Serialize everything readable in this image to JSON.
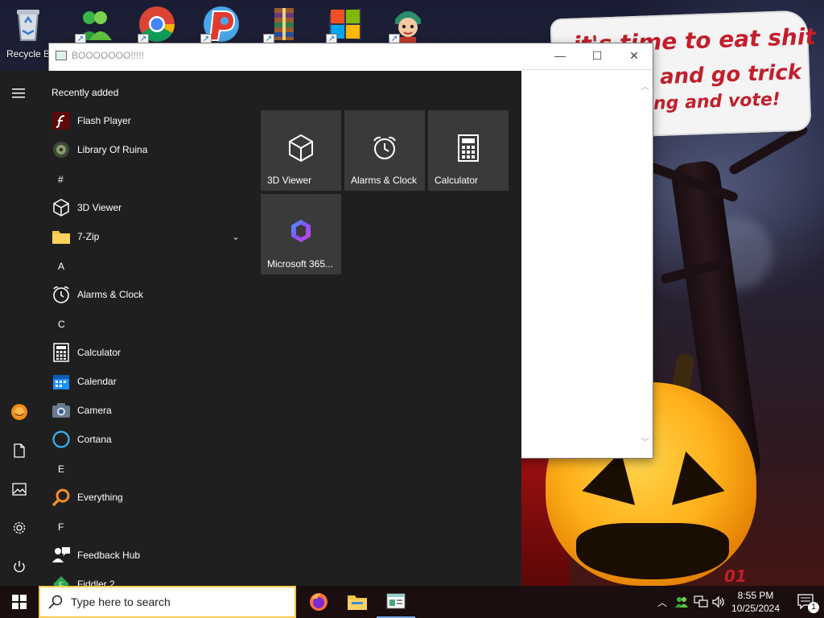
{
  "wallpaper": {
    "speech_lines": [
      "it's time to eat shit",
      "and go trick",
      "ng and vote!"
    ],
    "signature": "01"
  },
  "desktop": {
    "icons": [
      {
        "label": "Recycle B",
        "icon": "recycle-bin-icon"
      },
      {
        "label": "",
        "icon": "contacts-icon"
      },
      {
        "label": "",
        "icon": "chrome-icon"
      },
      {
        "label": "",
        "icon": "p-app-icon"
      },
      {
        "label": "",
        "icon": "winrar-icon"
      },
      {
        "label": "",
        "icon": "windows-logo-icon"
      },
      {
        "label": "",
        "icon": "character-icon"
      }
    ]
  },
  "window": {
    "title": "BOOOOOOO!!!!!",
    "minimize": "—",
    "maximize": "☐",
    "close": "✕"
  },
  "start_menu": {
    "recently_added_header": "Recently added",
    "apps": [
      {
        "name": "Flash Player",
        "icon": "flash-player-icon"
      },
      {
        "name": "Library Of Ruina",
        "icon": "library-of-ruina-icon"
      },
      {
        "header": "#"
      },
      {
        "name": "3D Viewer",
        "icon": "3d-viewer-icon"
      },
      {
        "name": "7-Zip",
        "icon": "folder-icon"
      },
      {
        "header": "A"
      },
      {
        "name": "Alarms & Clock",
        "icon": "alarm-clock-icon"
      },
      {
        "header": "C"
      },
      {
        "name": "Calculator",
        "icon": "calculator-icon"
      },
      {
        "name": "Calendar",
        "icon": "calendar-icon"
      },
      {
        "name": "Camera",
        "icon": "camera-icon"
      },
      {
        "name": "Cortana",
        "icon": "cortana-icon"
      },
      {
        "header": "E"
      },
      {
        "name": "Everything",
        "icon": "search-magnifier-icon"
      },
      {
        "header": "F"
      },
      {
        "name": "Feedback Hub",
        "icon": "feedback-hub-icon"
      },
      {
        "name": "Fiddler 2",
        "icon": "fiddler-icon"
      }
    ],
    "tiles": [
      {
        "label": "3D Viewer",
        "icon": "3d-viewer-icon"
      },
      {
        "label": "Alarms & Clock",
        "icon": "alarm-clock-icon"
      },
      {
        "label": "Calculator",
        "icon": "calculator-icon"
      },
      {
        "label": "Microsoft 365...",
        "icon": "microsoft-365-icon"
      }
    ],
    "rail": [
      "hamburger-menu-icon",
      "user-avatar-icon",
      "documents-icon",
      "pictures-icon",
      "settings-gear-icon",
      "power-icon"
    ]
  },
  "taskbar": {
    "search_placeholder": "Type here to search",
    "pinned": [
      "firefox-icon",
      "file-explorer-icon",
      "app-window-icon"
    ],
    "tray": [
      "chevron-up-icon",
      "people-icon",
      "network-icon",
      "volume-icon"
    ],
    "time": "8:55 PM",
    "date": "10/25/2024",
    "notification_count": "1"
  }
}
